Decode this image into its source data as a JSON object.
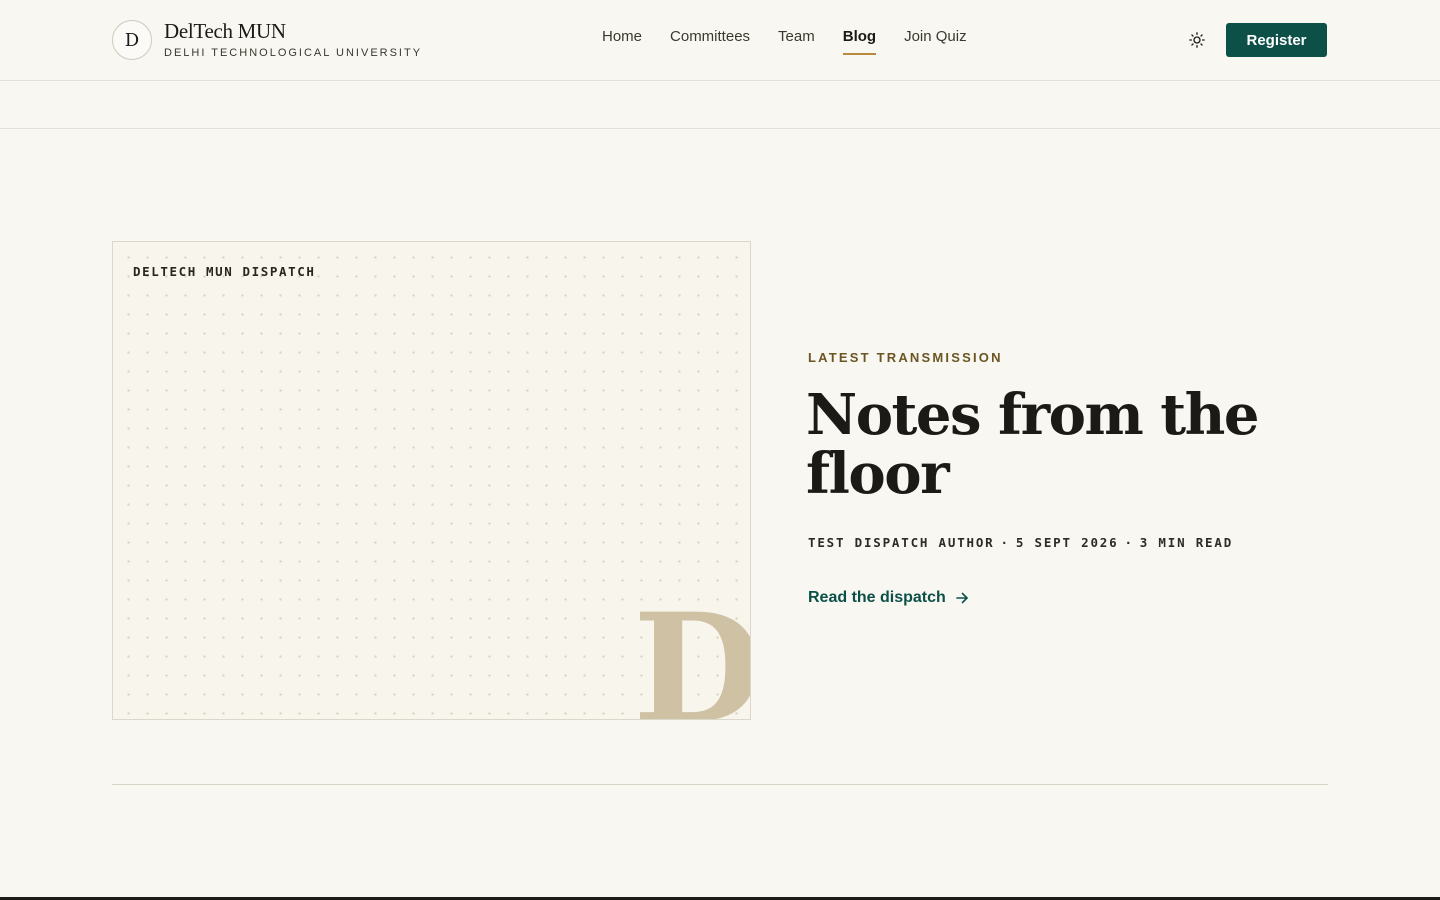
{
  "brand": {
    "mark": "D",
    "name": "DelTech MUN",
    "subtitle": "DELHI TECHNOLOGICAL UNIVERSITY"
  },
  "nav": {
    "items": [
      {
        "label": "Home",
        "active": false
      },
      {
        "label": "Committees",
        "active": false
      },
      {
        "label": "Team",
        "active": false
      },
      {
        "label": "Blog",
        "active": true
      },
      {
        "label": "Join Quiz",
        "active": false
      }
    ]
  },
  "header": {
    "theme_icon": "sun-icon",
    "register_label": "Register"
  },
  "hero": {
    "card_label": "DELTECH MUN DISPATCH",
    "card_mark": "D",
    "eyebrow": "LATEST TRANSMISSION",
    "title": "Notes from the floor",
    "meta": {
      "author": "TEST DISPATCH AUTHOR",
      "date": "5 SEPT 2026",
      "read_time": "3 MIN READ",
      "separator": "·"
    },
    "cta_label": "Read the dispatch",
    "cta_icon": "arrow-right-icon"
  },
  "colors": {
    "background": "#f9f7f2",
    "accent": "#0c5048",
    "active_underline": "#b8893f",
    "eyebrow": "#6b5522"
  }
}
